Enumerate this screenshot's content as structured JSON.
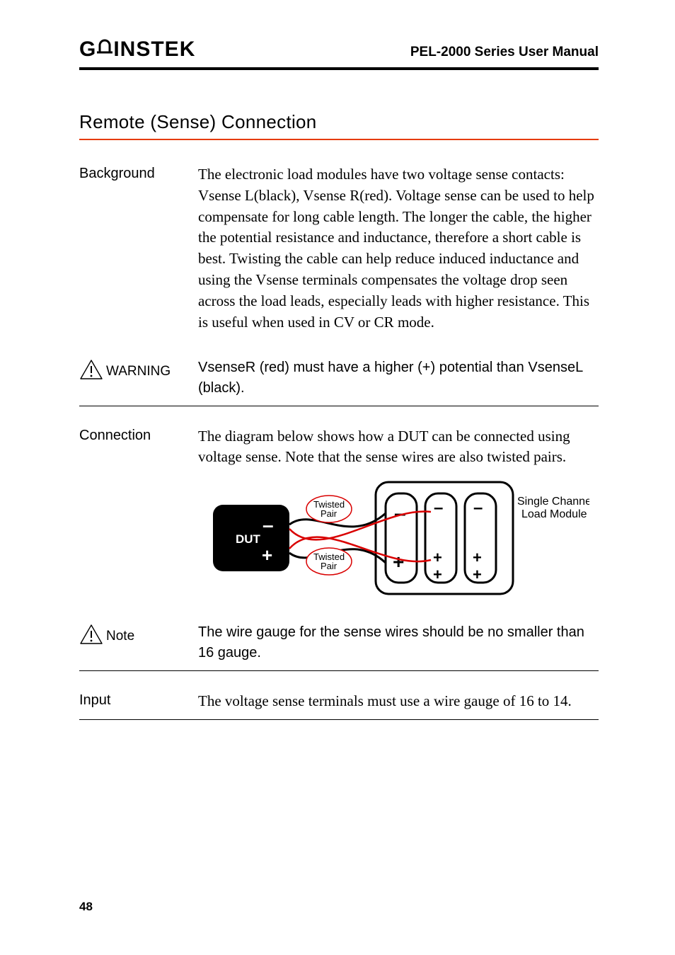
{
  "header": {
    "brand_left": "G",
    "brand_right": "INSTEK",
    "title": "PEL-2000 Series User Manual"
  },
  "section": {
    "title": "Remote (Sense) Connection"
  },
  "blocks": {
    "background": {
      "label": "Background",
      "text": "The electronic load modules have two voltage sense contacts: Vsense L(black), Vsense R(red). Voltage sense can be used to help compensate for long cable length. The longer the cable, the higher the potential resistance and inductance, therefore a short cable is best. Twisting the cable can help reduce induced inductance and using the Vsense terminals compensates the voltage drop seen across the load leads, especially leads with higher resistance. This is useful when used in CV or CR mode."
    },
    "warning": {
      "label": "WARNING",
      "text": "VsenseR (red) must have a higher (+) potential than VsenseL (black)."
    },
    "connection": {
      "label": "Connection",
      "text": "The diagram below shows how a DUT can be connected using voltage sense. Note that the sense wires are also twisted pairs."
    },
    "note": {
      "label": "Note",
      "text": "The wire gauge for the sense wires should be no smaller than 16 gauge."
    },
    "input": {
      "label": "Input",
      "text": "The voltage sense terminals must use a wire gauge of 16 to 14."
    }
  },
  "figure": {
    "dut_label": "DUT",
    "twisted_pair_top": "Twisted",
    "pair_top": "Pair",
    "twisted_pair_bottom": "Twisted",
    "pair_bottom": "Pair",
    "module_line1": "Single Channel",
    "module_line2": "Load Module",
    "minus": "–",
    "plus": "+"
  },
  "page_number": "48"
}
